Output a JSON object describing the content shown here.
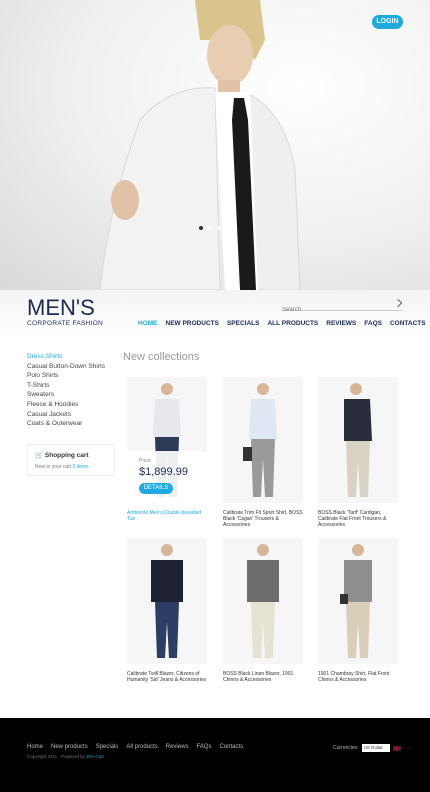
{
  "header": {
    "login_label": "LOGIN",
    "slider_dots": 4
  },
  "logo": {
    "title": "MEN'S",
    "subtitle": "CORPORATE FASHION"
  },
  "search": {
    "placeholder": "Search"
  },
  "nav": {
    "items": [
      "HOME",
      "NEW PRODUCTS",
      "SPECIALS",
      "ALL PRODUCTS",
      "REVIEWS",
      "FAQS",
      "CONTACTS"
    ],
    "active": "HOME"
  },
  "sidebar": {
    "categories": [
      "Dress Shirts",
      "Casual Button-Down Shirts",
      "Polo Shirts",
      "T-Shirts",
      "Sweaters",
      "Fleece & Hoodies",
      "Casual Jackets",
      "Coats & Outerwear"
    ],
    "cart": {
      "title": "Shopping cart",
      "line_prefix": "Now in your cart",
      "items": "0 items"
    }
  },
  "main": {
    "section_title": "New collections",
    "featured": {
      "label": "Price:",
      "price": "$1,899.99",
      "details_label": "DETAILS"
    },
    "products": [
      {
        "name": "Ambiente Men's Double-breasted Tux"
      },
      {
        "name": "Calibrate Trim Fit Sport Shirt, BOSS Black 'Cagan' Trousers & Accessories"
      },
      {
        "name": "BOSS Black 'Tarif' Cardigan, Calibrate Flat Front Trousers & Accessories"
      },
      {
        "name": "Calibrate Twill Blazer, Citizens of Humanity 'Sid' Jeans & Accessories"
      },
      {
        "name": "BOSS Black Linen Blazer, 1901 Chinos & Accessories"
      },
      {
        "name": "1901 Chambray Shirt, Flat Front Chinos & Accessories"
      }
    ]
  },
  "footer": {
    "links": [
      "Home",
      "New products",
      "Specials",
      "All products",
      "Reviews",
      "FAQs",
      "Contacts"
    ],
    "copyright_prefix": "Copyright 2011 · Powered by",
    "brand": "Zen Cart",
    "currencies_label": "Currencies:",
    "currency_value": "US Dollar"
  },
  "colors": {
    "accent": "#1fa9e1",
    "brand": "#1c2a56",
    "footer_bg": "#000000"
  }
}
